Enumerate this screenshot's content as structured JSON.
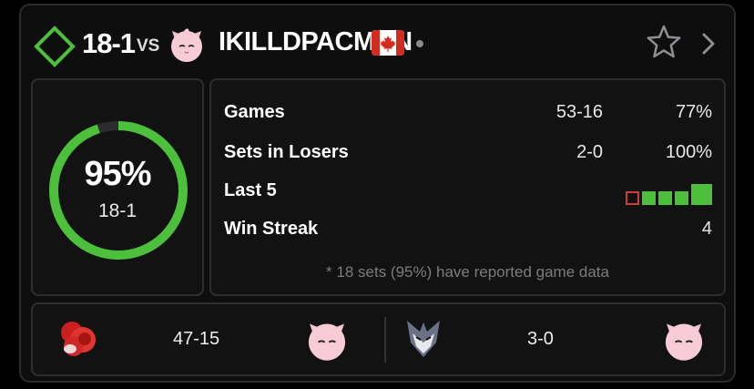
{
  "header": {
    "record": "18-1",
    "vs_label": "VS",
    "opponent_name": "IKILLDPACMAN",
    "accent_color": "#4cc03a",
    "icons": [
      "diamond-icon",
      "jigglypuff-icon",
      "canada-flag-icon",
      "star-icon",
      "chevron-right-icon"
    ]
  },
  "summary": {
    "win_percent_label": "95%",
    "win_fraction": 0.95,
    "record": "18-1"
  },
  "stats": {
    "games": {
      "label": "Games",
      "score": "53-16",
      "percent": "77%"
    },
    "losers": {
      "label": "Sets in Losers",
      "score": "2-0",
      "percent": "100%"
    },
    "last5": {
      "label": "Last 5",
      "results": [
        "L",
        "W",
        "W",
        "W",
        "W"
      ]
    },
    "streak": {
      "label": "Win Streak",
      "value": "4"
    },
    "footnote": "* 18 sets (95%) have reported game data"
  },
  "matchups": [
    {
      "player_char": "ice-climbers-icon",
      "score": "47-15",
      "opp_char": "jigglypuff-icon"
    },
    {
      "player_char": "falco-icon",
      "score": "3-0",
      "opp_char": "jigglypuff-icon"
    }
  ]
}
